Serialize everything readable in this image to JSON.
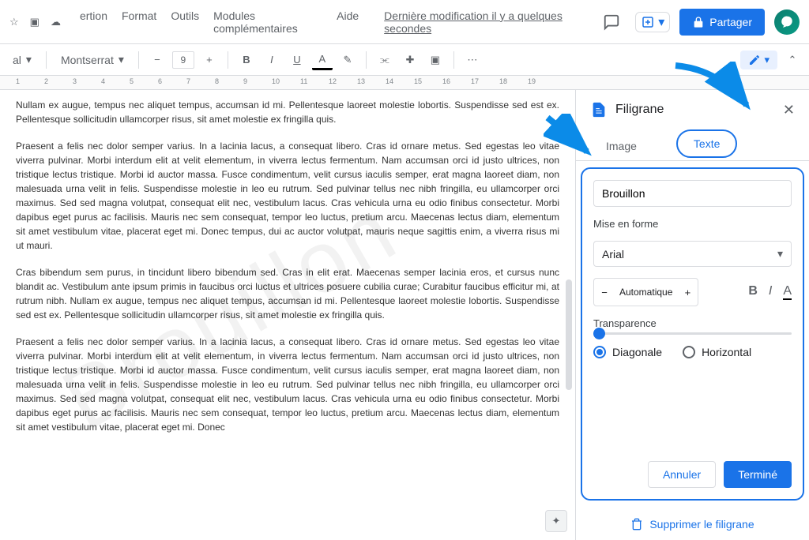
{
  "menubar": {
    "items": [
      "ertion",
      "Format",
      "Outils",
      "Modules complémentaires",
      "Aide"
    ]
  },
  "lastEdit": "Dernière modification il y a quelques secondes",
  "share": "Partager",
  "toolbar": {
    "style": "al",
    "font": "Montserrat",
    "size": "9"
  },
  "page": {
    "p1": "Nullam ex augue, tempus nec aliquet tempus, accumsan id mi. Pellentesque laoreet molestie lobortis. Suspendisse sed est ex. Pellentesque sollicitudin ullamcorper risus, sit amet molestie ex fringilla quis.",
    "p2": "Praesent a felis nec dolor semper varius. In a lacinia lacus, a consequat libero. Cras id ornare metus. Sed egestas leo vitae viverra pulvinar. Morbi interdum elit at velit elementum, in viverra lectus fermentum. Nam accumsan orci id justo ultrices, non tristique lectus tristique. Morbi id auctor massa. Fusce condimentum, velit cursus iaculis semper, erat magna laoreet diam, non malesuada urna velit in felis. Suspendisse molestie in leo eu rutrum. Sed pulvinar tellus nec nibh fringilla, eu ullamcorper orci maximus. Sed sed magna volutpat, consequat elit nec, vestibulum lacus. Cras vehicula urna eu odio finibus consectetur. Morbi dapibus eget purus ac facilisis. Mauris nec sem consequat, tempor leo luctus, pretium arcu. Maecenas lectus diam, elementum sit amet vestibulum vitae, placerat eget mi. Donec tempus, dui ac auctor volutpat, mauris neque sagittis enim, a viverra risus mi ut mauri.",
    "p3": "Cras bibendum sem purus, in tincidunt libero bibendum sed. Cras in elit erat. Maecenas semper lacinia eros, et cursus nunc blandit ac. Vestibulum ante ipsum primis in faucibus orci luctus et ultrices posuere cubilia curae; Curabitur faucibus efficitur mi, at rutrum nibh. Nullam ex augue, tempus nec aliquet tempus, accumsan id mi. Pellentesque laoreet molestie lobortis. Suspendisse sed est ex. Pellentesque sollicitudin ullamcorper risus, sit amet molestie ex fringilla quis.",
    "p4": "Praesent a felis nec dolor semper varius. In a lacinia lacus, a consequat libero. Cras id ornare metus. Sed egestas leo vitae viverra pulvinar. Morbi interdum elit at velit elementum, in viverra lectus fermentum. Nam accumsan orci id justo ultrices, non tristique lectus tristique. Morbi id auctor massa. Fusce condimentum, velit cursus iaculis semper, erat magna laoreet diam, non malesuada urna velit in felis. Suspendisse molestie in leo eu rutrum. Sed pulvinar tellus nec nibh fringilla, eu ullamcorper orci maximus. Sed sed magna volutpat, consequat elit nec, vestibulum lacus. Cras vehicula urna eu odio finibus consectetur. Morbi dapibus eget purus ac facilisis. Mauris nec sem consequat, tempor leo luctus, pretium arcu. Maecenas lectus diam, elementum sit amet vestibulum vitae, placerat eget mi. Donec"
  },
  "watermark": {
    "text": "Brouillon"
  },
  "sidebar": {
    "title": "Filigrane",
    "tabImage": "Image",
    "tabText": "Texte",
    "input": "Brouillon",
    "sectionFormat": "Mise en forme",
    "font": "Arial",
    "sizeValue": "Automatique",
    "transparency": "Transparence",
    "diag": "Diagonale",
    "horiz": "Horizontal",
    "cancel": "Annuler",
    "done": "Terminé",
    "delete": "Supprimer le filigrane"
  },
  "ruler": {
    "nums": [
      "1",
      "2",
      "3",
      "4",
      "5",
      "6",
      "7",
      "8",
      "9",
      "10",
      "11",
      "12",
      "13",
      "14",
      "15",
      "16",
      "17",
      "18",
      "19"
    ]
  }
}
